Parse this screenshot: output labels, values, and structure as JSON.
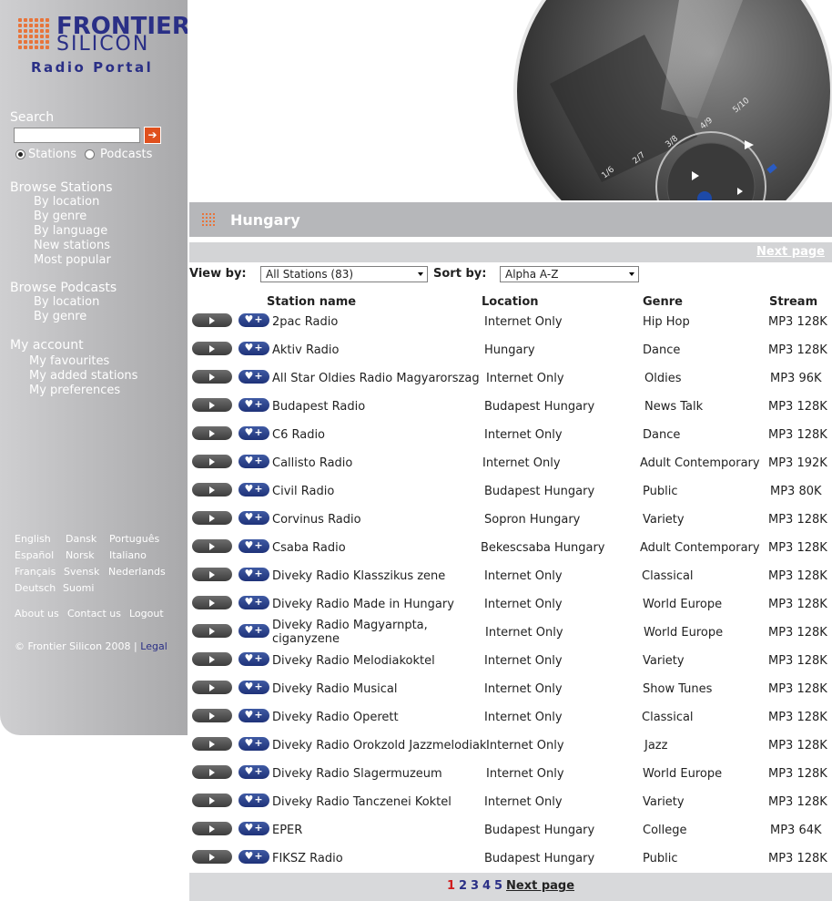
{
  "brand": {
    "line1": "FRONTIER",
    "line2": "SILICON",
    "portal": "Radio Portal"
  },
  "colors": {
    "accent": "#e8743a",
    "brand_blue": "#2a2f86",
    "sidebar": "#bdbdbf",
    "search_go": "#e0501d",
    "current_page": "#d01c1c"
  },
  "search": {
    "heading": "Search",
    "value": "",
    "go_icon": "arrow-right-icon",
    "options": [
      "Stations",
      "Podcasts"
    ],
    "selected": "Stations"
  },
  "browse_stations": {
    "heading": "Browse Stations",
    "items": [
      "By location",
      "By genre",
      "By language",
      "New stations",
      "Most popular"
    ]
  },
  "browse_podcasts": {
    "heading": "Browse Podcasts",
    "items": [
      "By location",
      "By genre"
    ]
  },
  "account": {
    "heading": "My account",
    "items": [
      "My favourites",
      "My added stations",
      "My preferences"
    ]
  },
  "languages": [
    [
      "English",
      "Dansk",
      "Português"
    ],
    [
      "Español",
      "Norsk",
      "Italiano"
    ],
    [
      "Français",
      "Svensk",
      "Nederlands"
    ],
    [
      "Deutsch",
      "Suomi"
    ]
  ],
  "footer_links": [
    "About us",
    "Contact us",
    "Logout"
  ],
  "copyright": "© Frontier Silicon 2008 |",
  "legal": "Legal",
  "page_title": "Hungary",
  "next_page_label": "Next page",
  "filters": {
    "view_label": "View by:",
    "view_value": "All Stations (83)",
    "sort_label": "Sort by:",
    "sort_value": "Alpha A-Z"
  },
  "columns": {
    "name": "Station name",
    "location": "Location",
    "genre": "Genre",
    "stream": "Stream"
  },
  "rows": [
    {
      "name": "2pac Radio",
      "location": "Internet Only",
      "genre": "Hip Hop",
      "stream": "MP3 128K"
    },
    {
      "name": "Aktiv Radio",
      "location": "Hungary",
      "genre": "Dance",
      "stream": "MP3 128K"
    },
    {
      "name": "All Star Oldies Radio Magyarorszag",
      "location": "Internet Only",
      "genre": "Oldies",
      "stream": "MP3 96K"
    },
    {
      "name": "Budapest Radio",
      "location": "Budapest Hungary",
      "genre": "News Talk",
      "stream": "MP3 128K"
    },
    {
      "name": "C6 Radio",
      "location": "Internet Only",
      "genre": "Dance",
      "stream": "MP3 128K"
    },
    {
      "name": "Callisto Radio",
      "location": "Internet Only",
      "genre": "Adult Contemporary",
      "stream": "MP3 192K"
    },
    {
      "name": "Civil Radio",
      "location": "Budapest Hungary",
      "genre": "Public",
      "stream": "MP3 80K"
    },
    {
      "name": "Corvinus Radio",
      "location": "Sopron Hungary",
      "genre": "Variety",
      "stream": "MP3 128K"
    },
    {
      "name": "Csaba Radio",
      "location": "Bekescsaba Hungary",
      "genre": "Adult Contemporary",
      "stream": "MP3 128K"
    },
    {
      "name": "Diveky Radio Klasszikus zene",
      "location": "Internet Only",
      "genre": "Classical",
      "stream": "MP3 128K"
    },
    {
      "name": "Diveky Radio Made in Hungary",
      "location": "Internet Only",
      "genre": "World Europe",
      "stream": "MP3 128K"
    },
    {
      "name": "Diveky Radio Magyarnpta, ciganyzene",
      "location": "Internet Only",
      "genre": "World Europe",
      "stream": "MP3 128K"
    },
    {
      "name": "Diveky Radio Melodiakoktel",
      "location": "Internet Only",
      "genre": "Variety",
      "stream": "MP3 128K"
    },
    {
      "name": "Diveky Radio Musical",
      "location": "Internet Only",
      "genre": "Show Tunes",
      "stream": "MP3 128K"
    },
    {
      "name": "Diveky Radio Operett",
      "location": "Internet Only",
      "genre": "Classical",
      "stream": "MP3 128K"
    },
    {
      "name": "Diveky Radio Orokzold Jazzmelodiak",
      "location": "Internet Only",
      "genre": "Jazz",
      "stream": "MP3 128K"
    },
    {
      "name": "Diveky Radio Slagermuzeum",
      "location": "Internet Only",
      "genre": "World Europe",
      "stream": "MP3 128K"
    },
    {
      "name": "Diveky Radio Tanczenei Koktel",
      "location": "Internet Only",
      "genre": "Variety",
      "stream": "MP3 128K"
    },
    {
      "name": "EPER",
      "location": "Budapest Hungary",
      "genre": "College",
      "stream": "MP3 64K"
    },
    {
      "name": "FIKSZ Radio",
      "location": "Budapest Hungary",
      "genre": "Public",
      "stream": "MP3 128K"
    }
  ],
  "row_buttons": {
    "play_icon": "play-icon",
    "fav_icon": "heart-plus-icon",
    "fav_glyph": "♥+"
  },
  "pager": {
    "pages": [
      "1",
      "2",
      "3",
      "4",
      "5"
    ],
    "current": "1",
    "next": "Next page"
  },
  "hero": {
    "device_labels": [
      "1/6",
      "2/7",
      "3/8",
      "4/9",
      "5/10"
    ]
  }
}
